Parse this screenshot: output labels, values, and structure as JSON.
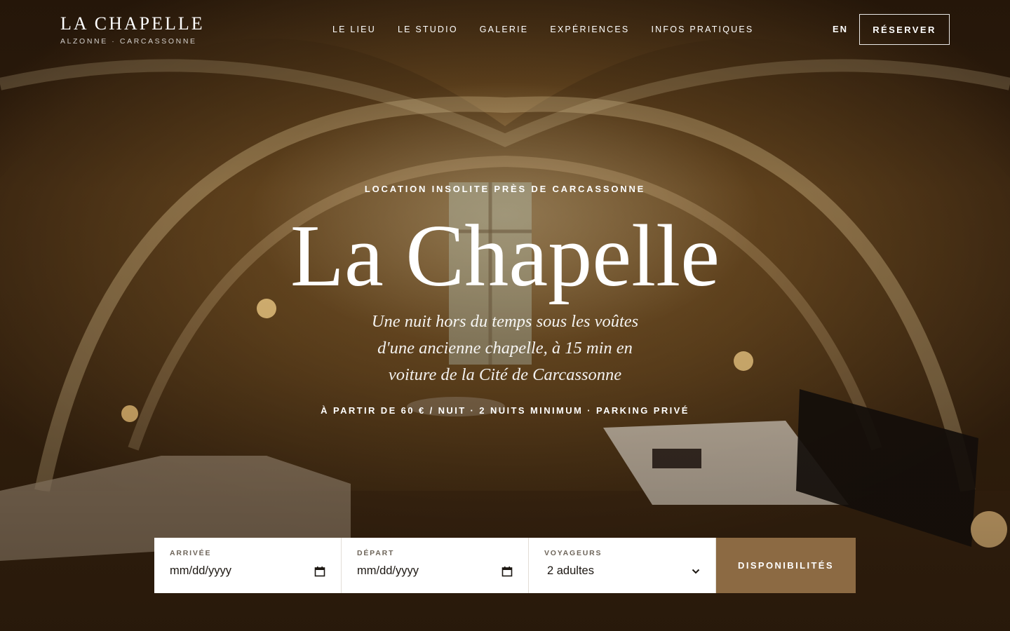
{
  "brand": {
    "title": "LA CHAPELLE",
    "subtitle": "ALZONNE · CARCASSONNE"
  },
  "nav": {
    "items": [
      {
        "label": "LE LIEU"
      },
      {
        "label": "LE STUDIO"
      },
      {
        "label": "GALERIE"
      },
      {
        "label": "EXPÉRIENCES"
      },
      {
        "label": "INFOS PRATIQUES"
      }
    ]
  },
  "header_actions": {
    "language": "EN",
    "book_label": "RÉSERVER"
  },
  "hero": {
    "eyebrow": "LOCATION INSOLITE PRÈS DE CARCASSONNE",
    "title": "La Chapelle",
    "tagline": "Une nuit hors du temps sous les voûtes d'une ancienne chapelle, à 15 min en voiture de la Cité de Carcassonne",
    "meta": "À PARTIR DE 60 € / NUIT · 2 NUITS MINIMUM · PARKING PRIVÉ"
  },
  "booking": {
    "arrival": {
      "label": "ARRIVÉE",
      "value": "mm/dd/yyyy",
      "icon": "calendar-icon"
    },
    "departure": {
      "label": "DÉPART",
      "value": "mm/dd/yyyy",
      "icon": "calendar-icon"
    },
    "guests": {
      "label": "VOYAGEURS",
      "value": "2 adultes",
      "icon": "chevron-down-icon"
    },
    "submit_label": "DISPONIBILITÉS"
  },
  "colors": {
    "accent": "#8c6a43",
    "text_light": "#ffffff",
    "field_bg": "#ffffff"
  }
}
